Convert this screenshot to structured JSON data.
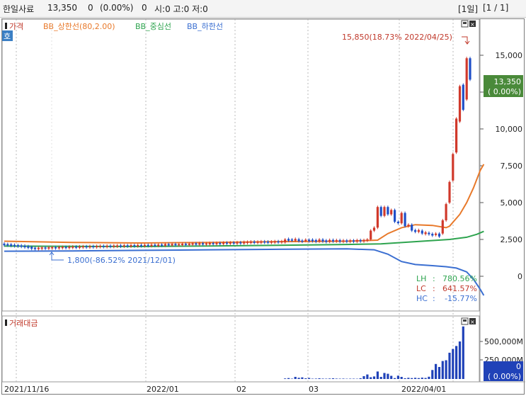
{
  "header": {
    "stock_name": "한일사료",
    "price": "13,350",
    "change": "0",
    "change_pct": "(0.00%)",
    "volume": "0",
    "ohlc": "시:0 고:0 저:0",
    "period": "[1일]",
    "page": "[1 / 1]"
  },
  "price_panel": {
    "legend": [
      {
        "label": "가격",
        "color": "#c0392b"
      },
      {
        "label": "BB_상한선(80,2.00)",
        "color": "#e8792a"
      },
      {
        "label": "BB_중심선",
        "color": "#2ea44f"
      },
      {
        "label": "BB_하한선",
        "color": "#3b6fd1"
      }
    ],
    "side_marker": "호",
    "high_annotation": "15,850(18.73% 2022/04/25)",
    "low_annotation": "1,800(-86.52% 2021/12/01)",
    "current_price_label": "13,350",
    "current_change_label": "( 0.00%)",
    "stats": [
      {
        "label": "LH",
        "value": "780.56%",
        "color": "#2ea44f"
      },
      {
        "label": "LC",
        "value": "641.57%",
        "color": "#c0392b"
      },
      {
        "label": "HC",
        "value": "-15.77%",
        "color": "#3b6fd1"
      }
    ],
    "y_ticks": [
      "15,000",
      "12,500",
      "10,000",
      "7,500",
      "5,000",
      "2,500",
      "0"
    ]
  },
  "volume_panel": {
    "legend": "거래대금",
    "y_ticks": [
      "500,000M",
      "250,000M"
    ],
    "current_label": "0",
    "current_change_label": "( 0.00%)"
  },
  "x_labels": [
    "2021/11/16",
    "2022/01",
    "02",
    "03",
    "2022/04/01"
  ],
  "chart_data": {
    "type": "candlestick",
    "period": "daily",
    "x": [
      "2021/11/16",
      "2022/01",
      "02",
      "03",
      "2022/04/01"
    ],
    "ylim": [
      0,
      16500
    ],
    "series": [
      {
        "name": "가격",
        "values": [
          {
            "o": 2180,
            "c": 2140
          },
          {
            "o": 2150,
            "c": 2130
          },
          {
            "o": 2130,
            "c": 2100
          },
          {
            "o": 2100,
            "c": 2080
          },
          {
            "o": 2080,
            "c": 2060
          },
          {
            "o": 2060,
            "c": 2040
          },
          {
            "o": 2040,
            "c": 2000
          },
          {
            "o": 2000,
            "c": 1960
          },
          {
            "o": 1960,
            "c": 1900
          },
          {
            "o": 1900,
            "c": 1880
          },
          {
            "o": 1880,
            "c": 1900
          },
          {
            "o": 1900,
            "c": 1920
          },
          {
            "o": 1920,
            "c": 1910
          },
          {
            "o": 1910,
            "c": 1930
          },
          {
            "o": 1930,
            "c": 1940
          },
          {
            "o": 1940,
            "c": 1930
          },
          {
            "o": 1930,
            "c": 1950
          },
          {
            "o": 1950,
            "c": 1960
          },
          {
            "o": 1960,
            "c": 1950
          },
          {
            "o": 1950,
            "c": 1970
          },
          {
            "o": 1970,
            "c": 1980
          },
          {
            "o": 1980,
            "c": 1970
          },
          {
            "o": 1970,
            "c": 1990
          },
          {
            "o": 1990,
            "c": 2000
          },
          {
            "o": 2000,
            "c": 1990
          },
          {
            "o": 1990,
            "c": 2010
          },
          {
            "o": 2010,
            "c": 2000
          },
          {
            "o": 2000,
            "c": 2020
          },
          {
            "o": 2020,
            "c": 2030
          },
          {
            "o": 2030,
            "c": 2020
          },
          {
            "o": 2020,
            "c": 2040
          },
          {
            "o": 2040,
            "c": 2030
          },
          {
            "o": 2030,
            "c": 2050
          },
          {
            "o": 2050,
            "c": 2060
          },
          {
            "o": 2060,
            "c": 2050
          },
          {
            "o": 2050,
            "c": 2070
          },
          {
            "o": 2070,
            "c": 2060
          },
          {
            "o": 2060,
            "c": 2080
          },
          {
            "o": 2080,
            "c": 2070
          },
          {
            "o": 2070,
            "c": 2090
          },
          {
            "o": 2090,
            "c": 2080
          },
          {
            "o": 2080,
            "c": 2100
          },
          {
            "o": 2100,
            "c": 2090
          },
          {
            "o": 2090,
            "c": 2110
          },
          {
            "o": 2110,
            "c": 2100
          },
          {
            "o": 2100,
            "c": 2120
          },
          {
            "o": 2120,
            "c": 2110
          },
          {
            "o": 2110,
            "c": 2150
          },
          {
            "o": 2150,
            "c": 2130
          },
          {
            "o": 2130,
            "c": 2160
          },
          {
            "o": 2160,
            "c": 2140
          },
          {
            "o": 2140,
            "c": 2150
          },
          {
            "o": 2150,
            "c": 2170
          },
          {
            "o": 2170,
            "c": 2160
          },
          {
            "o": 2160,
            "c": 2180
          },
          {
            "o": 2180,
            "c": 2200
          },
          {
            "o": 2200,
            "c": 2180
          },
          {
            "o": 2180,
            "c": 2210
          },
          {
            "o": 2210,
            "c": 2190
          },
          {
            "o": 2190,
            "c": 2200
          },
          {
            "o": 2200,
            "c": 2220
          },
          {
            "o": 2220,
            "c": 2210
          },
          {
            "o": 2210,
            "c": 2230
          },
          {
            "o": 2230,
            "c": 2220
          },
          {
            "o": 2220,
            "c": 2250
          },
          {
            "o": 2250,
            "c": 2240
          },
          {
            "o": 2240,
            "c": 2260
          },
          {
            "o": 2260,
            "c": 2250
          },
          {
            "o": 2250,
            "c": 2270
          },
          {
            "o": 2270,
            "c": 2260
          },
          {
            "o": 2260,
            "c": 2290
          },
          {
            "o": 2290,
            "c": 2300
          },
          {
            "o": 2300,
            "c": 2320
          },
          {
            "o": 2320,
            "c": 2300
          },
          {
            "o": 2300,
            "c": 2310
          },
          {
            "o": 2310,
            "c": 2330
          },
          {
            "o": 2330,
            "c": 2320
          },
          {
            "o": 2320,
            "c": 2310
          },
          {
            "o": 2310,
            "c": 2320
          },
          {
            "o": 2320,
            "c": 2340
          },
          {
            "o": 2340,
            "c": 2330
          },
          {
            "o": 2330,
            "c": 2340
          },
          {
            "o": 2300,
            "c": 2500
          },
          {
            "o": 2500,
            "c": 2450
          },
          {
            "o": 2500,
            "c": 2420
          },
          {
            "o": 2450,
            "c": 2500
          },
          {
            "o": 2480,
            "c": 2420
          },
          {
            "o": 2430,
            "c": 2350
          },
          {
            "o": 2400,
            "c": 2480
          },
          {
            "o": 2480,
            "c": 2380
          },
          {
            "o": 2450,
            "c": 2420
          },
          {
            "o": 2420,
            "c": 2380
          },
          {
            "o": 2400,
            "c": 2460
          },
          {
            "o": 2460,
            "c": 2400
          },
          {
            "o": 2400,
            "c": 2360
          },
          {
            "o": 2380,
            "c": 2430
          },
          {
            "o": 2430,
            "c": 2400
          },
          {
            "o": 2400,
            "c": 2420
          },
          {
            "o": 2420,
            "c": 2380
          },
          {
            "o": 2380,
            "c": 2400
          },
          {
            "o": 2400,
            "c": 2380
          },
          {
            "o": 2380,
            "c": 2400
          },
          {
            "o": 2400,
            "c": 2380
          },
          {
            "o": 2380,
            "c": 2420
          },
          {
            "o": 2420,
            "c": 2400
          },
          {
            "o": 2400,
            "c": 2420
          },
          {
            "o": 2420,
            "c": 2500
          },
          {
            "o": 2500,
            "c": 3100
          },
          {
            "o": 3100,
            "c": 3300
          },
          {
            "o": 3300,
            "c": 4700
          },
          {
            "o": 4700,
            "c": 4100
          },
          {
            "o": 4100,
            "c": 4700
          },
          {
            "o": 4700,
            "c": 4200
          },
          {
            "o": 4200,
            "c": 4500
          },
          {
            "o": 4500,
            "c": 3700
          },
          {
            "o": 3700,
            "c": 3600
          },
          {
            "o": 3600,
            "c": 4300
          },
          {
            "o": 4300,
            "c": 3400
          },
          {
            "o": 3400,
            "c": 3500
          },
          {
            "o": 3500,
            "c": 3100
          },
          {
            "o": 3100,
            "c": 3050
          },
          {
            "o": 3050,
            "c": 3100
          },
          {
            "o": 3100,
            "c": 2900
          },
          {
            "o": 2900,
            "c": 2950
          },
          {
            "o": 2950,
            "c": 2850
          },
          {
            "o": 2850,
            "c": 2800
          },
          {
            "o": 2800,
            "c": 2900
          },
          {
            "o": 2900,
            "c": 2700
          },
          {
            "o": 2900,
            "c": 3800
          },
          {
            "o": 3800,
            "c": 4900
          },
          {
            "o": 5000,
            "c": 6400
          },
          {
            "o": 6500,
            "c": 8300
          },
          {
            "o": 8400,
            "c": 10700
          },
          {
            "o": 10500,
            "c": 12900
          },
          {
            "o": 13000,
            "c": 11300
          },
          {
            "o": 12000,
            "c": 14800
          },
          {
            "o": 14800,
            "c": 13350
          }
        ]
      },
      {
        "name": "BB_상한선",
        "values": [
          [
            0,
            2380
          ],
          [
            20,
            2300
          ],
          [
            40,
            2260
          ],
          [
            60,
            2300
          ],
          [
            80,
            2350
          ],
          [
            100,
            2380
          ],
          [
            109,
            2450
          ],
          [
            112,
            2900
          ],
          [
            116,
            3300
          ],
          [
            120,
            3500
          ],
          [
            125,
            3450
          ],
          [
            129,
            3300
          ],
          [
            130,
            3400
          ],
          [
            133,
            4200
          ],
          [
            135,
            5000
          ],
          [
            137,
            6000
          ],
          [
            139,
            7200
          ],
          [
            140,
            7600
          ]
        ]
      },
      {
        "name": "BB_중심선",
        "values": [
          [
            0,
            2050
          ],
          [
            20,
            2030
          ],
          [
            40,
            2020
          ],
          [
            60,
            2060
          ],
          [
            80,
            2100
          ],
          [
            100,
            2160
          ],
          [
            110,
            2200
          ],
          [
            120,
            2350
          ],
          [
            130,
            2500
          ],
          [
            135,
            2650
          ],
          [
            138,
            2850
          ],
          [
            140,
            3050
          ]
        ]
      },
      {
        "name": "BB_하한선",
        "values": [
          [
            0,
            1700
          ],
          [
            20,
            1720
          ],
          [
            40,
            1760
          ],
          [
            60,
            1800
          ],
          [
            80,
            1830
          ],
          [
            100,
            1860
          ],
          [
            108,
            1800
          ],
          [
            112,
            1500
          ],
          [
            116,
            1000
          ],
          [
            120,
            800
          ],
          [
            125,
            720
          ],
          [
            129,
            650
          ],
          [
            132,
            560
          ],
          [
            135,
            300
          ],
          [
            137,
            -200
          ],
          [
            139,
            -900
          ],
          [
            140,
            -1300
          ]
        ]
      }
    ],
    "volume": [
      0,
      0,
      0,
      0,
      0,
      0,
      0,
      0,
      0,
      0,
      0,
      0,
      0,
      0,
      0,
      0,
      0,
      0,
      0,
      0,
      0,
      0,
      0,
      0,
      0,
      0,
      0,
      0,
      0,
      0,
      0,
      0,
      0,
      0,
      0,
      0,
      0,
      0,
      0,
      0,
      0,
      0,
      0,
      0,
      0,
      0,
      0,
      0,
      0,
      0,
      0,
      0,
      0,
      0,
      0,
      0,
      0,
      0,
      0,
      0,
      0,
      0,
      0,
      0,
      0,
      0,
      0,
      0,
      0,
      0,
      0,
      0,
      0,
      0,
      0,
      0,
      0,
      0,
      0,
      0,
      0,
      0,
      8000,
      12000,
      5000,
      28000,
      16000,
      22000,
      9000,
      14000,
      5000,
      6000,
      9000,
      6000,
      5000,
      7000,
      9000,
      6000,
      5000,
      6000,
      4000,
      5000,
      5000,
      4000,
      10000,
      38000,
      60000,
      24000,
      34000,
      100000,
      28000,
      80000,
      70000,
      42000,
      12000,
      44000,
      28000,
      10000,
      16000,
      12000,
      16000,
      12000,
      18000,
      14000,
      30000,
      120000,
      200000,
      160000,
      240000,
      250000,
      350000,
      400000,
      440000,
      500000,
      700000
    ]
  }
}
